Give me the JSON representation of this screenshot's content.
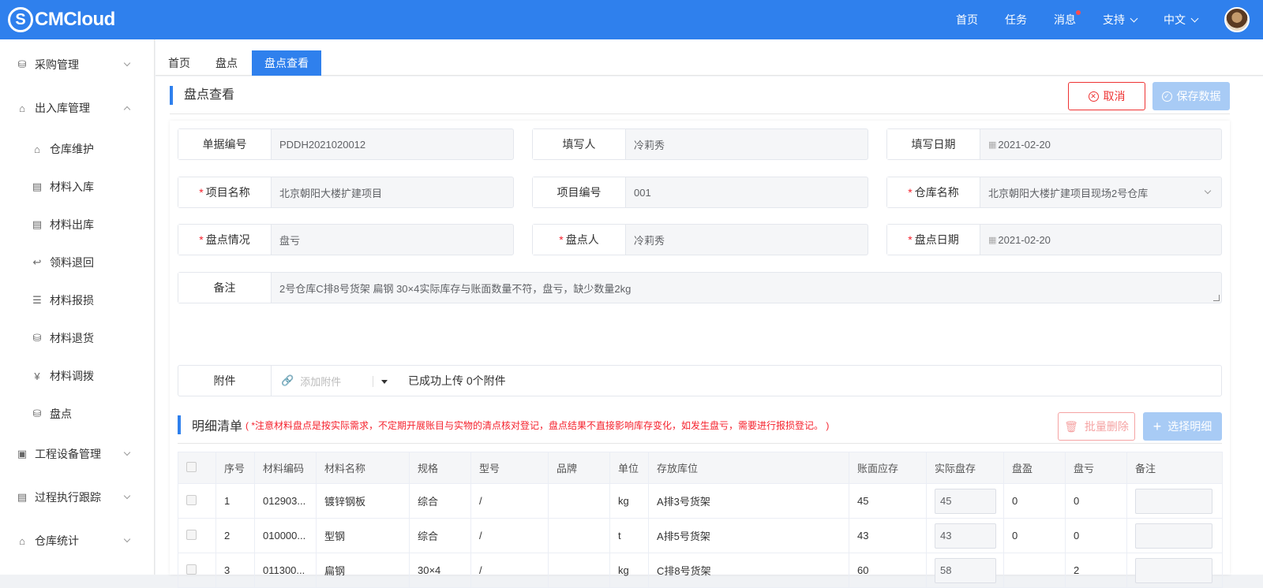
{
  "header": {
    "logo_text": "CMCloud",
    "nav": [
      {
        "label": "首页"
      },
      {
        "label": "任务"
      },
      {
        "label": "消息"
      },
      {
        "label": "支持"
      },
      {
        "label": "中文"
      }
    ]
  },
  "sidebar": {
    "items": [
      {
        "label": "采购管理"
      },
      {
        "label": "出入库管理"
      },
      {
        "label": "仓库维护"
      },
      {
        "label": "材料入库"
      },
      {
        "label": "材料出库"
      },
      {
        "label": "领料退回"
      },
      {
        "label": "材料报损"
      },
      {
        "label": "材料退货"
      },
      {
        "label": "材料调拨"
      },
      {
        "label": "盘点"
      },
      {
        "label": "工程设备管理"
      },
      {
        "label": "过程执行跟踪"
      },
      {
        "label": "仓库统计"
      }
    ]
  },
  "tabs": [
    {
      "label": "首页"
    },
    {
      "label": "盘点"
    },
    {
      "label": "盘点查看"
    }
  ],
  "page": {
    "title": "盘点查看",
    "cancel_label": "取消",
    "save_label": "保存数据"
  },
  "form": {
    "doc_no": {
      "label": "单据编号",
      "value": "PDDH2021020012"
    },
    "writer": {
      "label": "填写人",
      "value": "冷莉秀"
    },
    "write_date": {
      "label": "填写日期",
      "value": "2021-02-20"
    },
    "project_name": {
      "label": "项目名称",
      "value": "北京朝阳大楼扩建项目"
    },
    "project_no": {
      "label": "项目编号",
      "value": "001"
    },
    "warehouse": {
      "label": "仓库名称",
      "value": "北京朝阳大楼扩建项目现场2号仓库"
    },
    "check_status": {
      "label": "盘点情况",
      "value": "盘亏"
    },
    "checker": {
      "label": "盘点人",
      "value": "冷莉秀"
    },
    "check_date": {
      "label": "盘点日期",
      "value": "2021-02-20"
    },
    "remark": {
      "label": "备注",
      "value": "2号仓库C排8号货架 扁钢 30×4实际库存与账面数量不符，盘亏，缺少数量2kg"
    },
    "attachment": {
      "label": "附件",
      "add_label": "添加附件",
      "status": "已成功上传 0个附件"
    },
    "required_mark": "*"
  },
  "detail": {
    "title": "明细清单",
    "note": "( *注意材料盘点是按实际需求，不定期开展账目与实物的清点核对登记，盘点结果不直接影响库存变化，如发生盘亏，需要进行报损登记。 )",
    "batch_delete_label": "批量删除",
    "select_label": "选择明细",
    "columns": [
      "序号",
      "材料编码",
      "材料名称",
      "规格",
      "型号",
      "品牌",
      "单位",
      "存放库位",
      "账面应存",
      "实际盘存",
      "盘盈",
      "盘亏",
      "备注"
    ],
    "rows": [
      {
        "no": "1",
        "code": "012903...",
        "name": "镀锌钢板",
        "spec": "综合",
        "model": "/",
        "brand": "",
        "unit": "kg",
        "loc": "A排3号货架",
        "book": "45",
        "actual": "45",
        "gain": "0",
        "loss": "0",
        "remark": ""
      },
      {
        "no": "2",
        "code": "010000...",
        "name": "型钢",
        "spec": "综合",
        "model": "/",
        "brand": "",
        "unit": "t",
        "loc": "A排5号货架",
        "book": "43",
        "actual": "43",
        "gain": "0",
        "loss": "0",
        "remark": ""
      },
      {
        "no": "3",
        "code": "011300...",
        "name": "扁钢",
        "spec": "30×4",
        "model": "/",
        "brand": "",
        "unit": "kg",
        "loc": "C排8号货架",
        "book": "60",
        "actual": "58",
        "gain": "",
        "loss": "2",
        "remark": ""
      }
    ]
  }
}
